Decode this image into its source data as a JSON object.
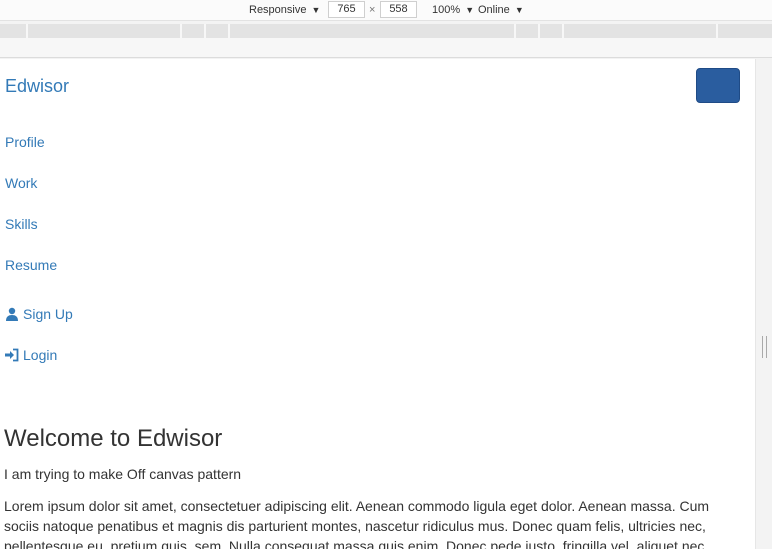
{
  "devtools": {
    "mode": "Responsive",
    "width": "765",
    "times": "×",
    "height": "558",
    "zoom": "100%",
    "network": "Online",
    "caret": "▼"
  },
  "site": {
    "brand": "Edwisor",
    "nav": {
      "profile": "Profile",
      "work": "Work",
      "skills": "Skills",
      "resume": "Resume",
      "signup": "Sign Up",
      "login": "Login"
    },
    "icons": {
      "user": "user-icon",
      "login": "log-in-icon"
    },
    "main": {
      "title": "Welcome to Edwisor",
      "lead": "I am trying to make Off canvas pattern",
      "paragraph": "Lorem ipsum dolor sit amet, consectetuer adipiscing elit. Aenean commodo ligula eget dolor. Aenean massa. Cum sociis natoque penatibus et magnis dis parturient montes, nascetur ridiculus mus. Donec quam felis, ultricies nec, pellentesque eu, pretium quis, sem. Nulla consequat massa quis enim. Donec pede justo, fringilla vel, aliquet nec,"
    }
  },
  "colors": {
    "link": "#337ab7",
    "toggle": "#2a5d9f",
    "text": "#333333"
  }
}
